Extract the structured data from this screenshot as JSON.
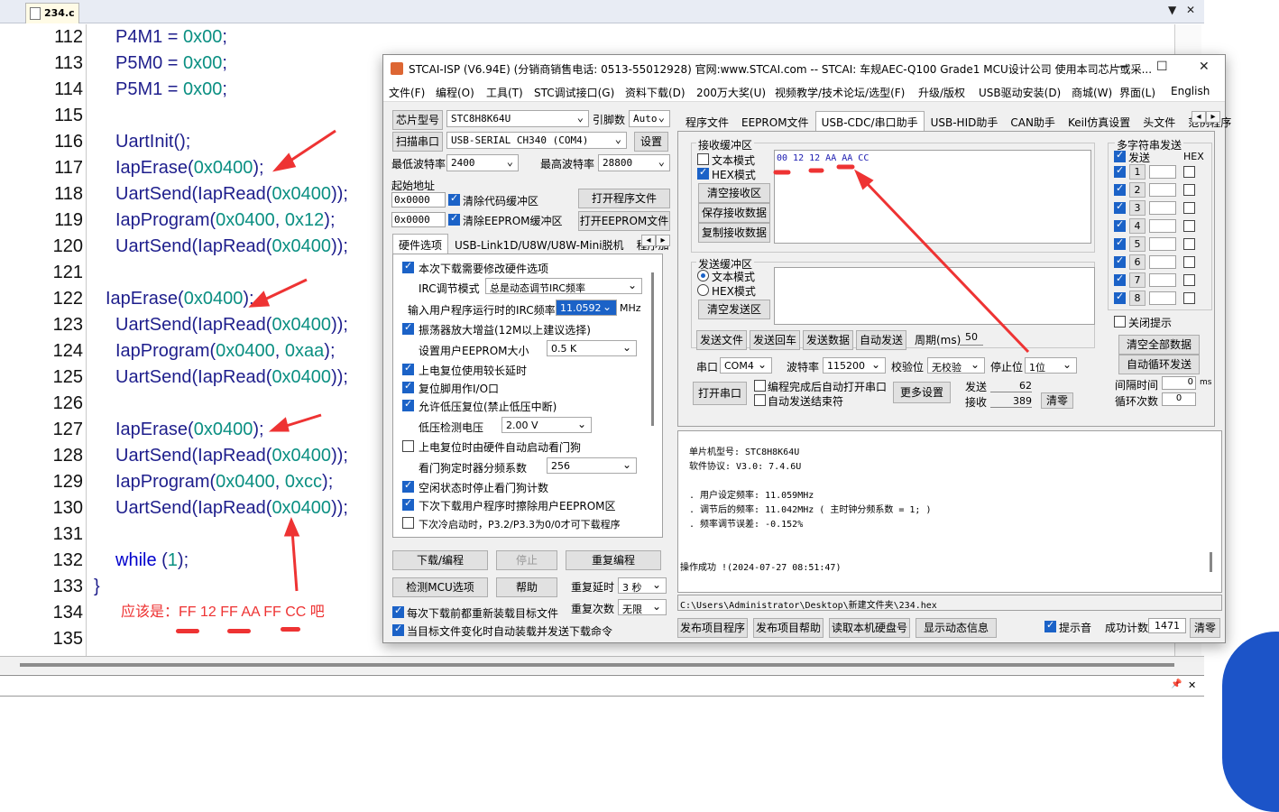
{
  "editor": {
    "tab": "234.c",
    "tab_controls": [
      "▼",
      "✕"
    ],
    "line_numbers": [
      "112",
      "113",
      "114",
      "115",
      "116",
      "117",
      "118",
      "119",
      "120",
      "121",
      "122",
      "123",
      "124",
      "125",
      "126",
      "127",
      "128",
      "129",
      "130",
      "131",
      "132",
      "133",
      "134",
      "135"
    ],
    "annotation": "应该是：FF  12  FF  AA  FF  CC  吧",
    "bottom_controls": [
      "📌",
      "✕"
    ]
  },
  "isp": {
    "title": "STCAI-ISP (V6.94E) (分销商销售电话: 0513-55012928) 官网:www.STCAI.com  -- STCAI: 车规AEC-Q100 Grade1 MCU设计公司 使用本司芯片或采...",
    "window_buttons": [
      "—",
      "☐",
      "✕"
    ],
    "menu": [
      "文件(F)",
      "编程(O)",
      "工具(T)",
      "STC调试接口(G)",
      "资料下载(D)",
      "200万大奖(U)",
      "视频教学/技术论坛/选型(F)",
      "升级/版权",
      "USB驱动安装(D)",
      "商城(W)",
      "界面(L)",
      "English"
    ],
    "left": {
      "chip_label": "芯片型号",
      "chip_value": "STC8H8K64U",
      "pin_label": "引脚数",
      "pin_value": "Auto",
      "scan_label": "扫描串口",
      "port_value": "USB-SERIAL CH340 (COM4)",
      "settings_label": "设置",
      "min_baud_label": "最低波特率",
      "min_baud_value": "2400",
      "max_baud_label": "最高波特率",
      "max_baud_value": "28800",
      "start_addr_label": "起始地址",
      "addr1": "0x0000",
      "clear_code_label": "清除代码缓冲区",
      "open_prog_label": "打开程序文件",
      "addr2": "0x0000",
      "clear_eeprom_label": "清除EEPROM缓冲区",
      "open_eeprom_label": "打开EEPROM文件",
      "hw_tabs": [
        "硬件选项",
        "USB-Link1D/U8W/U8W-Mini脱机",
        "程序加"
      ],
      "hw_opt1": "本次下载需要修改硬件选项",
      "irc_mode_label": "IRC调节模式",
      "irc_mode_value": "总是动态调节IRC频率",
      "irc_freq_label": "输入用户程序运行时的IRC频率",
      "irc_freq_value": "11.0592",
      "mhz": "MHz",
      "osc_label": "振荡器放大增益(12M以上建议选择)",
      "eeprom_size_label": "设置用户EEPROM大小",
      "eeprom_size_value": "0.5 K",
      "power_delay_label": "上电复位使用较长延时",
      "reset_io_label": "复位脚用作I/O口",
      "lvr_label": "允许低压复位(禁止低压中断)",
      "lvd_label": "低压检测电压",
      "lvd_value": "2.00 V",
      "wdt_label": "上电复位时由硬件自动启动看门狗",
      "wdt_div_label": "看门狗定时器分频系数",
      "wdt_div_value": "256",
      "idle_wdt_label": "空闲状态时停止看门狗计数",
      "erase_eeprom_label": "下次下载用户程序时擦除用户EEPROM区",
      "cold_boot_label": "下次冷启动时，P3.2/P3.3为0/0才可下载程序",
      "download_label": "下载/编程",
      "stop_label": "停止",
      "reprog_label": "重复编程",
      "detect_label": "检测MCU选项",
      "help_label": "帮助",
      "repeat_delay_label": "重复延时",
      "repeat_delay_value": "3 秒",
      "repeat_count_label": "重复次数",
      "repeat_count_value": "无限",
      "reload_label": "每次下载前都重新装载目标文件",
      "auto_label": "当目标文件变化时自动装载并发送下载命令"
    },
    "right_tabs": [
      "程序文件",
      "EEPROM文件",
      "USB-CDC/串口助手",
      "USB-HID助手",
      "CAN助手",
      "Keil仿真设置",
      "头文件",
      "范例程序"
    ],
    "recv": {
      "group_label": "接收缓冲区",
      "text_mode": "文本模式",
      "hex_mode": "HEX模式",
      "clear": "清空接收区",
      "save": "保存接收数据",
      "copy": "复制接收数据",
      "content": "00 12 12 AA AA CC"
    },
    "send": {
      "group_label": "发送缓冲区",
      "text_mode": "文本模式",
      "hex_mode": "HEX模式",
      "clear": "清空发送区",
      "send_file": "发送文件",
      "send_return": "发送回车",
      "send_data": "发送数据",
      "auto_send": "自动发送",
      "period_label": "周期(ms)",
      "period_value": "50"
    },
    "multi": {
      "group_label": "多字符串发送",
      "send_header": "发送",
      "hex_header": "HEX",
      "rows": [
        "1",
        "2",
        "3",
        "4",
        "5",
        "6",
        "7",
        "8"
      ],
      "close_tip": "关闭提示",
      "clear_all": "清空全部数据",
      "auto_loop": "自动循环发送",
      "interval_label": "间隔时间",
      "interval_value": "0",
      "ms": "ms",
      "loop_label": "循环次数",
      "loop_value": "0"
    },
    "serial": {
      "port_label": "串口",
      "port_value": "COM4",
      "baud_label": "波特率",
      "baud_value": "115200",
      "parity_label": "校验位",
      "parity_value": "无校验",
      "stop_label": "停止位",
      "stop_value": "1位",
      "open_label": "打开串口",
      "auto_open": "编程完成后自动打开串口",
      "auto_end": "自动发送结束符",
      "more": "更多设置",
      "sent_label": "发送",
      "sent_value": "62",
      "recv_label": "接收",
      "recv_value": "389",
      "clear_label": "清零"
    },
    "log": [
      "单片机型号: STC8H8K64U",
      "软件协议: V3.0: 7.4.6U",
      "",
      ". 用户设定频率: 11.059MHz",
      ". 调节后的频率: 11.042MHz ( 主时钟分频系数 = 1; )",
      ". 频率调节误差: -0.152%",
      "",
      "",
      "操作成功 !(2024-07-27 08:51:47)"
    ],
    "path": "C:\\Users\\Administrator\\Desktop\\新建文件夹\\234.hex",
    "bottom": {
      "publish_prog": "发布项目程序",
      "publish_help": "发布项目帮助",
      "read_disk": "读取本机硬盘号",
      "show_dyn": "显示动态信息",
      "tone_label": "提示音",
      "success_label": "成功计数",
      "success_value": "1471",
      "clear_label": "清零"
    }
  }
}
